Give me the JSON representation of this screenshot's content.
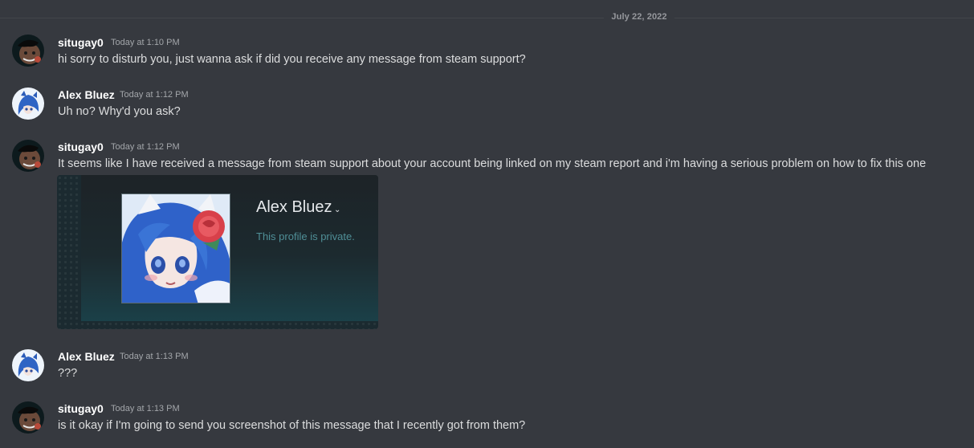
{
  "date_divider": "July 22, 2022",
  "messages": [
    {
      "author": "situgay0",
      "time": "Today at 1:10 PM",
      "text": "hi sorry to disturb you, just wanna ask if did you receive any message from steam support?"
    },
    {
      "author": "Alex Bluez",
      "time": "Today at 1:12 PM",
      "text": "Uh no? Why'd you ask?"
    },
    {
      "author": "situgay0",
      "time": "Today at 1:12 PM",
      "text": "It seems like I have received a message from steam support about your account being linked on my steam report and i'm having a serious problem on how to fix this one"
    },
    {
      "author": "Alex Bluez",
      "time": "Today at 1:13 PM",
      "text": "???"
    },
    {
      "author": "situgay0",
      "time": "Today at 1:13 PM",
      "text": "is it okay if I'm going to send you screenshot of this message that I recently got from them?"
    }
  ],
  "embed": {
    "profile_name": "Alex Bluez",
    "dropdown_glyph": "⌄",
    "status": "This profile is private."
  },
  "colors": {
    "background": "#36393f",
    "username": "#ffffff",
    "message_text": "#dcddde",
    "timestamp": "#a3a6aa",
    "embed_status": "#4f8f97"
  }
}
